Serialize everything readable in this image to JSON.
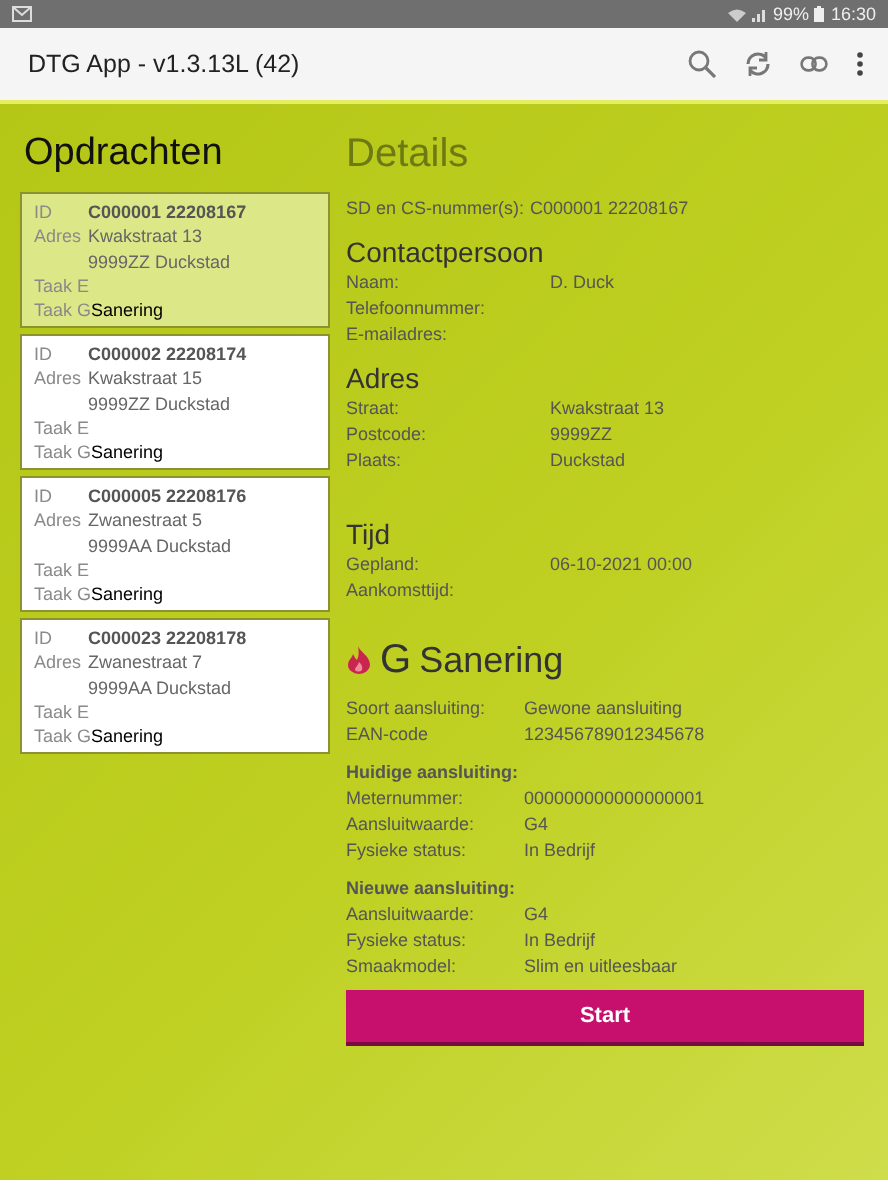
{
  "status_bar": {
    "battery": "99%",
    "time": "16:30"
  },
  "app_bar": {
    "title": "DTG App - v1.3.13L (42)"
  },
  "orders": {
    "title": "Opdrachten",
    "items": [
      {
        "id_label": "ID",
        "id": "C000001 22208167",
        "address_label": "Adres",
        "street": "Kwakstraat 13",
        "city": "9999ZZ Duckstad",
        "task_e_label": "Taak E",
        "task_g_label": "Taak G",
        "task_g": "Sanering",
        "selected": true
      },
      {
        "id_label": "ID",
        "id": "C000002 22208174",
        "address_label": "Adres",
        "street": "Kwakstraat 15",
        "city": "9999ZZ Duckstad",
        "task_e_label": "Taak E",
        "task_g_label": "Taak G",
        "task_g": "Sanering",
        "selected": false
      },
      {
        "id_label": "ID",
        "id": "C000005 22208176",
        "address_label": "Adres",
        "street": "Zwanestraat 5",
        "city": "9999AA Duckstad",
        "task_e_label": "Taak E",
        "task_g_label": "Taak G",
        "task_g": "Sanering",
        "selected": false
      },
      {
        "id_label": "ID",
        "id": "C000023 22208178",
        "address_label": "Adres",
        "street": "Zwanestraat 7",
        "city": "9999AA Duckstad",
        "task_e_label": "Taak E",
        "task_g_label": "Taak G",
        "task_g": "Sanering",
        "selected": false
      }
    ]
  },
  "details": {
    "title": "Details",
    "sections": [
      {
        "kind": "plain",
        "rows": [
          {
            "label": "SD en CS-nummer(s):",
            "value": "C000001 22208167"
          }
        ]
      },
      {
        "kind": "section",
        "title": "Contactpersoon",
        "rows": [
          {
            "label": "Naam:",
            "value": "D. Duck"
          },
          {
            "label": "Telefoonnummer:"
          },
          {
            "label": "E-mailadres:"
          }
        ]
      },
      {
        "kind": "section",
        "title": "Adres",
        "rows": [
          {
            "label": "Straat:",
            "value": "Kwakstraat 13"
          },
          {
            "label": "Postcode:",
            "value": "9999ZZ"
          },
          {
            "label": "Plaats:",
            "value": "Duckstad"
          }
        ]
      },
      {
        "kind": "section",
        "title": "Tijd",
        "rows": [
          {
            "label": "Gepland:",
            "value": "06-10-2021 00:00"
          },
          {
            "label": "Aankomsttijd:"
          }
        ]
      },
      {
        "kind": "task",
        "letter": "G",
        "title": "Sanering",
        "rows": [
          {
            "label": "Soort aansluiting:",
            "value": "Gewone aansluiting"
          },
          {
            "label": "EAN-code",
            "value": "123456789012345678"
          }
        ]
      },
      {
        "kind": "group",
        "title": "Huidige aansluiting:",
        "rows": [
          {
            "label": "Meternummer:",
            "value": "000000000000000001"
          },
          {
            "label": "Aansluitwaarde:",
            "value": "G4"
          },
          {
            "label": "Fysieke status:",
            "value": "In Bedrijf"
          }
        ]
      },
      {
        "kind": "group",
        "title": "Nieuwe aansluiting:",
        "rows": [
          {
            "label": "Aansluitwaarde:",
            "value": "G4"
          },
          {
            "label": "Fysieke status:",
            "value": "In Bedrijf"
          },
          {
            "label": "Smaakmodel:",
            "value": "Slim en uitleesbaar"
          }
        ]
      }
    ],
    "button": "Start"
  }
}
